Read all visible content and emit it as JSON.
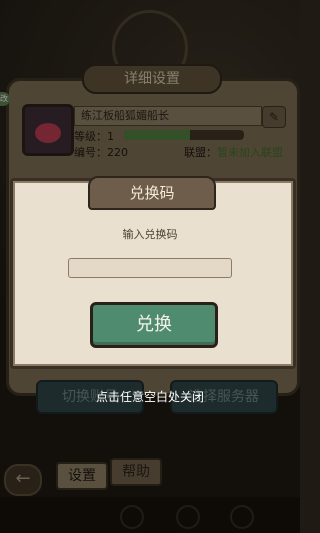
{
  "settings": {
    "title": "详细设置",
    "player_name": "练江板船狐媚船长",
    "edit_icon": "pencil-icon",
    "level_label": "等级：",
    "level_value": "1",
    "level_progress": 0.55,
    "id_label": "编号：",
    "id_value": "220",
    "alliance_label": "联盟：",
    "alliance_value": "暂未加入联盟",
    "switch_label": "切换账号",
    "server_label": "选择服务器",
    "tabs": [
      "设置",
      "帮助"
    ],
    "back_icon": "back-arrow-icon",
    "side_tag": "改"
  },
  "modal": {
    "title": "兑换码",
    "prompt": "输入兑换码",
    "input_value": "",
    "redeem_label": "兑换"
  },
  "close_hint": "点击任意空白处关闭",
  "colors": {
    "redeem_button": "#4f8b6e",
    "modal_bg": "#e9e0cf",
    "header_bg": "#6d5d4a",
    "alliance_green": "#3e6b2a"
  }
}
